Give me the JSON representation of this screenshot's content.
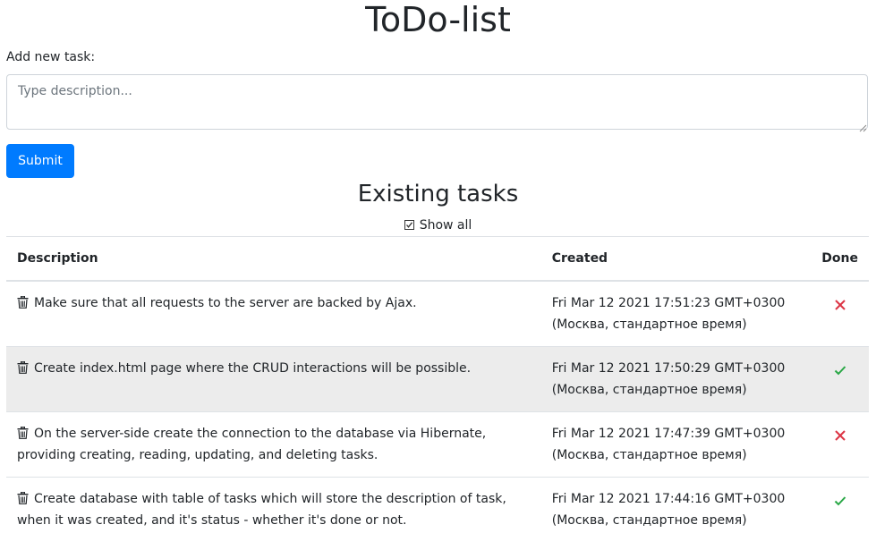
{
  "header": {
    "title": "ToDo-list"
  },
  "form": {
    "label": "Add new task:",
    "placeholder": "Type description...",
    "value": "",
    "submit_label": "Submit"
  },
  "tasks_section": {
    "title": "Existing tasks",
    "show_all_label": "Show all",
    "show_all_checked": true
  },
  "table": {
    "headers": {
      "description": "Description",
      "created": "Created",
      "done": "Done"
    },
    "rows": [
      {
        "description": "Make sure that all requests to the server are backed by Ajax.",
        "created": "Fri Mar 12 2021 17:51:23 GMT+0300 (Москва, стандартное время)",
        "done": false,
        "done_icon": "x-icon"
      },
      {
        "description": "Create index.html page where the CRUD interactions will be possible.",
        "created": "Fri Mar 12 2021 17:50:29 GMT+0300 (Москва, стандартное время)",
        "done": true,
        "done_icon": "check-icon"
      },
      {
        "description": "On the server-side create the connection to the database via Hibernate, providing creating, reading, updating, and deleting tasks.",
        "created": "Fri Mar 12 2021 17:47:39 GMT+0300 (Москва, стандартное время)",
        "done": false,
        "done_icon": "x-icon"
      },
      {
        "description": "Create database with table of tasks which will store the description of task, when it was created, and it's status - whether it's done or not.",
        "created": "Fri Mar 12 2021 17:44:16 GMT+0300 (Москва, стандартное время)",
        "done": true,
        "done_icon": "check-icon"
      }
    ]
  },
  "colors": {
    "primary": "#007bff",
    "done_true": "#28a745",
    "done_false": "#dc3545",
    "stripe": "#ececec"
  }
}
